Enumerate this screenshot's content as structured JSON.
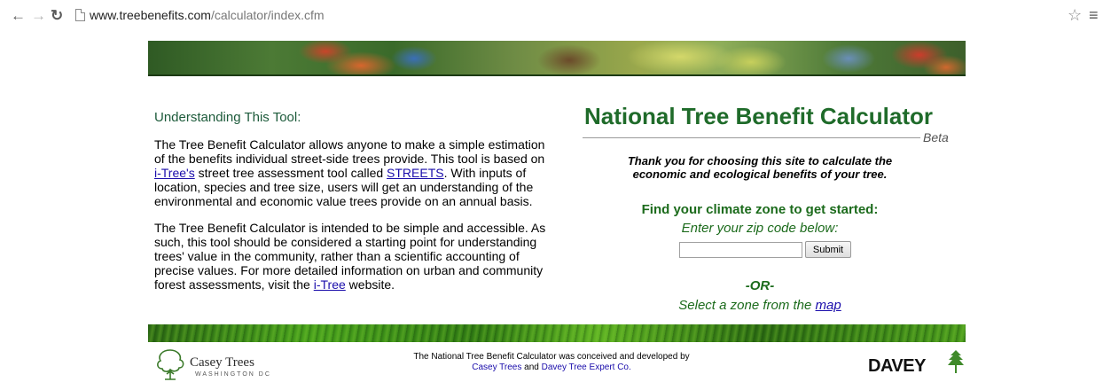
{
  "browser": {
    "url_host": "www.treebenefits.com",
    "url_path": "/calculator/index.cfm"
  },
  "left": {
    "section_title": "Understanding This Tool:",
    "para1": {
      "before_link1": "The Tree Benefit Calculator allows anyone to make a simple estimation of the benefits individual street-side trees provide. This tool is based on ",
      "link1": "i-Tree's",
      "between_links": " street tree assessment tool called ",
      "link2": "STREETS",
      "after_link2": ". With inputs of location, species and tree size, users will get an understanding of the environmental and economic value trees provide on an annual basis."
    },
    "para2": {
      "before_link": "The Tree Benefit Calculator is intended to be simple and accessible. As such, this tool should be considered a starting point for understanding trees' value in the community, rather than a scientific accounting of precise values. For more detailed information on urban and community forest assessments, visit the ",
      "link": "i-Tree",
      "after_link": " website."
    }
  },
  "right": {
    "title": "National Tree Benefit Calculator",
    "beta": "Beta",
    "thanks_line1": "Thank you for choosing this site to calculate the",
    "thanks_line2": "economic and ecological benefits of your tree.",
    "zone_heading": "Find your climate zone to get started:",
    "zip_prompt": "Enter your zip code below:",
    "zip_value": "",
    "submit_label": "Submit",
    "or_text": "-OR-",
    "map_before": "Select a zone from the ",
    "map_link": "map"
  },
  "footer": {
    "casey_name": "Casey Trees",
    "casey_sub": "WASHINGTON DC",
    "credit_line1": "The National Tree Benefit Calculator was conceived and developed by",
    "credit_link1": "Casey Trees",
    "credit_and": " and ",
    "credit_link2": "Davey Tree Expert Co.",
    "davey_name": "DAVEY"
  },
  "colors": {
    "heading_green": "#1f6b2a",
    "link_blue": "#1a0dab"
  }
}
